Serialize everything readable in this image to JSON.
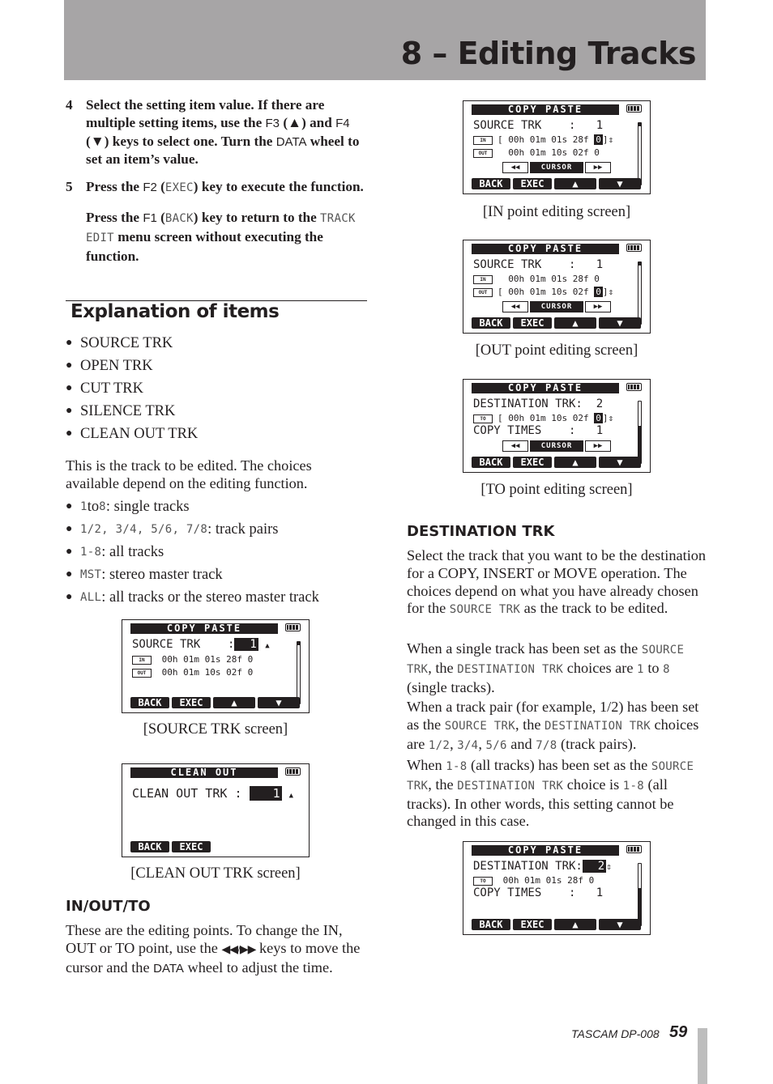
{
  "header": {
    "chapter_title": "8 – Editing Tracks"
  },
  "steps": [
    {
      "num": "4",
      "parts": [
        "Select the setting item value. If there are multiple setting items, use the ",
        "F3",
        " (▲) and ",
        "F4",
        " (▼) keys to select one. Turn the ",
        "DATA",
        " wheel to set an item’s value."
      ]
    },
    {
      "num": "5",
      "parts": [
        "Press the ",
        "F2",
        " (",
        "EXEC",
        ") key to execute the function."
      ]
    }
  ],
  "step5_cont": {
    "parts": [
      "Press the ",
      "F1",
      " (",
      "BACK",
      ") key to return to the ",
      "TRACK EDIT",
      " menu screen without executing the function."
    ]
  },
  "section": {
    "title": "Explanation of items"
  },
  "items": [
    "SOURCE TRK",
    "OPEN TRK",
    "CUT TRK",
    "SILENCE TRK",
    "CLEAN OUT TRK"
  ],
  "source_intro": "This is the track to be edited. The choices available depend on the editing function.",
  "choices": [
    {
      "code": "1",
      "mid": " to ",
      "code2": "8",
      "text": ": single tracks"
    },
    {
      "code": "1/2, 3/4, 5/6, 7/8",
      "mid": "",
      "code2": "",
      "text": ": track pairs"
    },
    {
      "code": "1-8",
      "mid": "",
      "code2": "",
      "text": ": all tracks"
    },
    {
      "code": "MST",
      "mid": "",
      "code2": "",
      "text": ": stereo master track"
    },
    {
      "code": "ALL",
      "mid": "",
      "code2": "",
      "text": ": all tracks or the stereo master track"
    }
  ],
  "screens": {
    "source": {
      "title": "COPY PASTE",
      "row1_label": "SOURCE TRK",
      "row1_sep": ":",
      "row1_value": "1",
      "arrow": "▲",
      "in_tag": "IN",
      "in_time": "00h 01m 01s 28f 0",
      "out_tag": "OUT",
      "out_time": "00h 01m 10s 02f 0",
      "fkeys": [
        "BACK",
        "EXEC",
        "▲",
        "▼"
      ],
      "caption": "[SOURCE TRK screen]"
    },
    "cleanout": {
      "title": "CLEAN OUT",
      "row1_label": "CLEAN OUT TRK",
      "row1_sep": ":",
      "row1_value": "1",
      "arrow": "▲",
      "fkeys": [
        "BACK",
        "EXEC"
      ],
      "caption": "[CLEAN OUT TRK screen]"
    },
    "in_point": {
      "title": "COPY PASTE",
      "row1_label": "SOURCE TRK",
      "row1_sep": ":",
      "row1_value": "1",
      "in_tag": "IN",
      "in_time": "[ 00h 01m 01s 28f ",
      "in_sub": "0",
      "in_end": "]",
      "updown": "⇕",
      "out_tag": "OUT",
      "out_time": "  00h 01m 10s 02f 0",
      "cursor": [
        "◀◀",
        "CURSOR",
        "▶▶"
      ],
      "fkeys": [
        "BACK",
        "EXEC",
        "▲",
        "▼"
      ],
      "caption": "[IN point editing screen]"
    },
    "out_point": {
      "title": "COPY PASTE",
      "row1_label": "SOURCE TRK",
      "row1_sep": ":",
      "row1_value": "1",
      "in_tag": "IN",
      "in_time": "  00h 01m 01s 28f 0",
      "out_tag": "OUT",
      "out_time": "[ 00h 01m 10s 02f ",
      "out_sub": "0",
      "out_end": "]",
      "updown": "⇕",
      "cursor": [
        "◀◀",
        "CURSOR",
        "▶▶"
      ],
      "fkeys": [
        "BACK",
        "EXEC",
        "▲",
        "▼"
      ],
      "caption": "[OUT point editing screen]"
    },
    "to_point": {
      "title": "COPY PASTE",
      "row1_label": "DESTINATION TRK:",
      "row1_value": "2",
      "to_tag": "TO",
      "to_time": "[ 00h 01m 10s 02f ",
      "to_sub": "0",
      "to_end": "]",
      "updown": "⇕",
      "row3_label": "COPY TIMES",
      "row3_sep": ":",
      "row3_value": "1",
      "cursor": [
        "◀◀",
        "CURSOR",
        "▶▶"
      ],
      "fkeys": [
        "BACK",
        "EXEC",
        "▲",
        "▼"
      ],
      "caption": "[TO point editing screen]"
    },
    "dest": {
      "title": "COPY PASTE",
      "row1_label": "DESTINATION TRK:",
      "row1_value": "2",
      "updown": "⇕",
      "to_tag": "TO",
      "to_time": "00h 01m 01s 28f 0",
      "row3_label": "COPY TIMES",
      "row3_sep": ":",
      "row3_value": "1",
      "fkeys": [
        "BACK",
        "EXEC",
        "▲",
        "▼"
      ]
    }
  },
  "inout": {
    "heading": "IN/OUT/TO",
    "parts": [
      "These are the editing points. To change the IN, OUT or TO point, use the ",
      "◀◀/▶▶",
      " keys to move the cursor and the ",
      "DATA",
      " wheel to adjust the time."
    ]
  },
  "destination": {
    "heading": "DESTINATION TRK",
    "p1": [
      "Select the track that you want to be the destination for a COPY, INSERT or MOVE operation. The choices depend on what you have already chosen for the ",
      "SOURCE TRK",
      " as the track to be edited."
    ],
    "p2": [
      "When a single track has been set as the ",
      "SOURCE TRK",
      ", the ",
      "DESTINATION TRK",
      " choices are ",
      "1",
      " to ",
      "8",
      " (single tracks)."
    ],
    "p3": [
      "When a track pair (for example, 1/2) has been set as the ",
      "SOURCE TRK",
      ", the ",
      "DESTINATION TRK",
      " choices are ",
      "1/2",
      ", ",
      "3/4",
      ", ",
      "5/6",
      " and ",
      "7/8",
      " (track pairs)."
    ],
    "p4": [
      "When ",
      "1-8",
      " (all tracks) has been set as the ",
      "SOURCE TRK",
      ", the ",
      "DESTINATION TRK",
      " choice is ",
      "1-8",
      " (all tracks). In other words, this setting cannot be changed in this case."
    ]
  },
  "footer": {
    "brand": "TASCAM  DP-008",
    "page": "59"
  }
}
